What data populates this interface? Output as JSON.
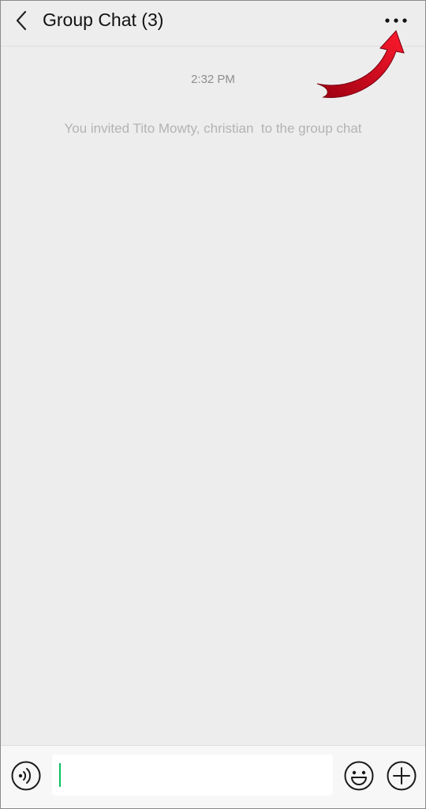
{
  "header": {
    "title": "Group Chat (3)",
    "back_icon": "chevron-left-icon",
    "more_icon": "more-dots-icon"
  },
  "messages": {
    "timestamp": "2:32 PM",
    "system_message": "You invited Tito Mowty, christian  to the group chat"
  },
  "composer": {
    "input_value": "",
    "voice_icon": "voice-icon",
    "emoji_icon": "emoji-icon",
    "plus_icon": "plus-icon"
  },
  "colors": {
    "background": "#ededed",
    "composer_background": "#f7f7f7",
    "cursor": "#07c160",
    "annotation_arrow": "#e0001a"
  }
}
